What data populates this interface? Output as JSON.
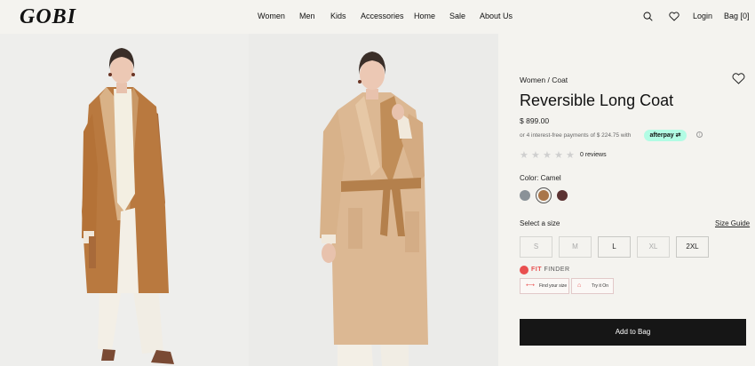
{
  "brand": {
    "logo": "GOBI"
  },
  "nav": {
    "items": [
      "Women",
      "Men",
      "Kids",
      "Accessories",
      "Home",
      "Sale",
      "About Us"
    ]
  },
  "header_right": {
    "login": "Login",
    "bag": "Bag [0]"
  },
  "icons": [
    "search-icon",
    "heart-icon",
    "wishlist-heart-icon",
    "fit-finder-logo-icon",
    "ruler-icon",
    "hanger-icon"
  ],
  "product": {
    "breadcrumb": "Women / Coat",
    "title": "Reversible Long Coat",
    "price": "$ 899.00",
    "installment": "or 4 interest-free payments of $ 224.75 with",
    "afterpay": "afterpay",
    "rating_stars": 0,
    "reviews": "0 reviews",
    "color_label": "Color: Camel",
    "colors": [
      {
        "name": "Grey",
        "hex": "#8a9298"
      },
      {
        "name": "Camel",
        "hex": "#a9764a",
        "selected": true
      },
      {
        "name": "Brown",
        "hex": "#5b3232"
      }
    ],
    "size_label": "Select a size",
    "size_guide": "Size Guide",
    "sizes": [
      {
        "label": "S",
        "available": false
      },
      {
        "label": "M",
        "available": false
      },
      {
        "label": "L",
        "available": true
      },
      {
        "label": "XL",
        "available": false
      },
      {
        "label": "2XL",
        "available": true
      }
    ],
    "fit_finder": {
      "brand": "FIT",
      "suffix": "FINDER",
      "find_size": "Find your size",
      "try_it_on": "Try it On"
    },
    "add_to_bag": "Add to Bag"
  },
  "colors": {
    "header_bg": "#f4f3ef",
    "button_bg": "#161616",
    "afterpay": "#b2fce4",
    "fit_finder": "#e94f4f",
    "coat_camel": "#b98754"
  }
}
